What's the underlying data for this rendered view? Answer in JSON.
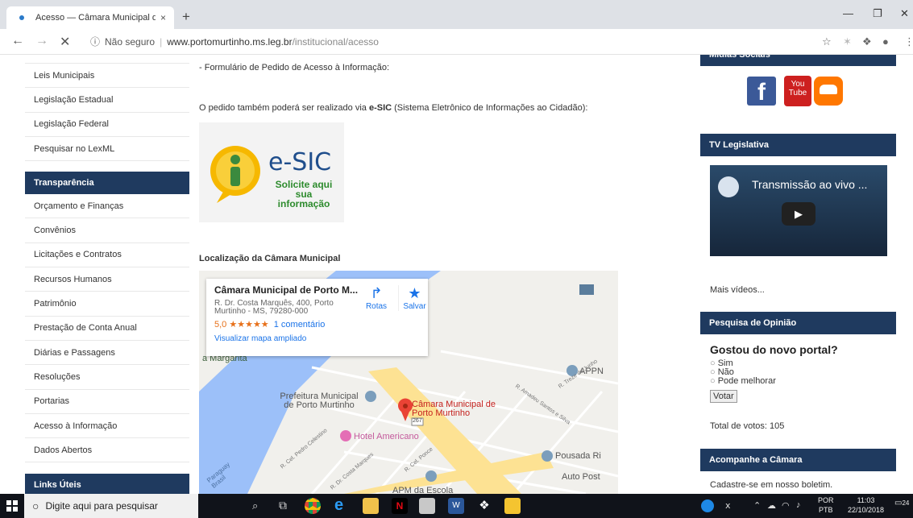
{
  "browser": {
    "tab_title": "Acesso — Câmara Municipal de P",
    "tab_close": "×",
    "new_tab": "+",
    "url_security": "Não seguro",
    "url_host": "www.portomurtinho.ms.leg.br",
    "url_path": "/institucional/acesso"
  },
  "sidebar": {
    "items_top": [
      "Leis Municipais",
      "Legislação Estadual",
      "Legislação Federal",
      "Pesquisar no LexML"
    ],
    "transparencia_title": "Transparência",
    "items_transparencia": [
      "Orçamento e Finanças",
      "Convênios",
      "Licitações e Contratos",
      "Recursos Humanos",
      "Patrimônio",
      "Prestação de Conta Anual",
      "Diárias e Passagens",
      "Resoluções",
      "Portarias",
      "Acesso à Informação",
      "Dados Abertos"
    ],
    "links_title": "Links Úteis"
  },
  "main": {
    "form_text": "- Formulário de Pedido de Acesso à Informação:",
    "esic_text_pre": "O pedido também poderá ser realizado via ",
    "esic_text_bold": "e-SIC",
    "esic_text_post": " (Sistema Eletrônico de Informações ao Cidadão):",
    "esic_logo_title": "e-SIC",
    "esic_logo_line1": "Solicite aqui",
    "esic_logo_line2": "sua informação",
    "location_title": "Localização da Câmara Municipal"
  },
  "map": {
    "card_title": "Câmara Municipal de Porto M...",
    "card_address": "R. Dr. Costa Marquês, 400, Porto Murtinho - MS, 79280-000",
    "rating": "5,0",
    "stars": "★★★★★",
    "reviews": "1 comentário",
    "enlarge_link": "Visualizar mapa ampliado",
    "routes_label": "Rotas",
    "save_label": "Salvar",
    "places": [
      "a Margarita",
      "Prefeitura Municipal de Porto Murtinho",
      "Câmara Municipal de Porto Murtinho",
      "Hotel Americano",
      "Pousada Ri",
      "Auto Post",
      "APM da Escola",
      "APPN"
    ],
    "streets": [
      "R. Amadeu Santos e Silva",
      "R. Treze de Junho",
      "R. Cel. Pedro Celestino",
      "R. Dr. Costa Marques",
      "R. Cel. Ponce",
      "Paraguay Brasil"
    ],
    "road_badge": "267"
  },
  "right": {
    "social_title": "Mídias Sociais",
    "tv_title": "TV Legislativa",
    "video_title": "Transmissão ao vivo ...",
    "more_videos": "Mais vídeos...",
    "poll_title": "Pesquisa de Opinião",
    "poll_question": "Gostou do novo portal?",
    "poll_options": [
      "Sim",
      "Não",
      "Pode melhorar"
    ],
    "vote_button": "Votar",
    "total_votes": "Total de votos: 105",
    "follow_title": "Acompanhe a Câmara",
    "newsletter": "Cadastre-se em nosso boletim."
  },
  "taskbar": {
    "search_placeholder": "Digite aqui para pesquisar",
    "lang_top": "POR",
    "lang_bottom": "PTB",
    "time": "11:03",
    "date": "22/10/2018",
    "notif_count": "24"
  },
  "colors": {
    "nav_dark": "#1f3a5f",
    "link_blue": "#1a73e8",
    "facebook": "#3b5998",
    "youtube": "#cd201f",
    "soundcloud": "#ff7700"
  }
}
